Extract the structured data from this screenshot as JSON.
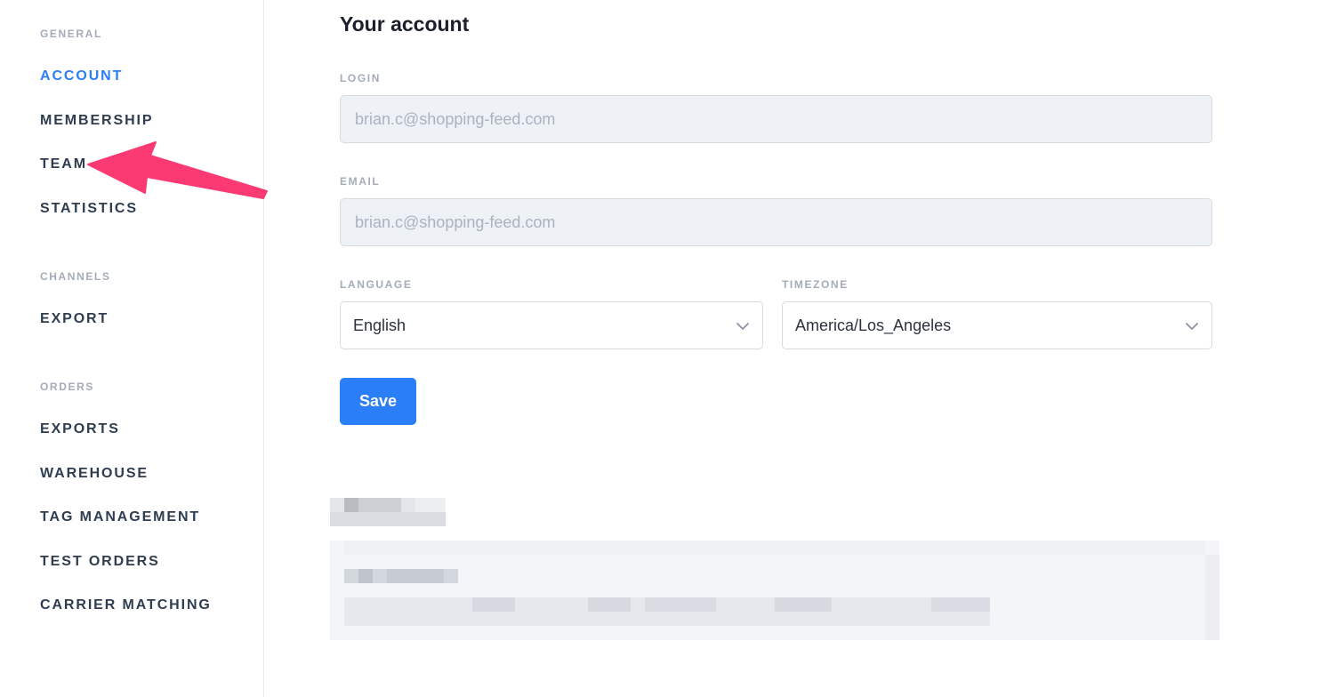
{
  "sidebar": {
    "groups": [
      {
        "title": "GENERAL",
        "items": [
          {
            "label": "ACCOUNT",
            "active": true
          },
          {
            "label": "MEMBERSHIP"
          },
          {
            "label": "TEAM"
          },
          {
            "label": "STATISTICS"
          }
        ]
      },
      {
        "title": "CHANNELS",
        "items": [
          {
            "label": "EXPORT"
          }
        ]
      },
      {
        "title": "ORDERS",
        "items": [
          {
            "label": "EXPORTS"
          },
          {
            "label": "WAREHOUSE"
          },
          {
            "label": "TAG MANAGEMENT"
          },
          {
            "label": "TEST ORDERS"
          },
          {
            "label": "CARRIER MATCHING"
          }
        ]
      }
    ]
  },
  "account": {
    "title": "Your account",
    "login": {
      "label": "LOGIN",
      "value": "brian.c@shopping-feed.com"
    },
    "email": {
      "label": "EMAIL",
      "value": "brian.c@shopping-feed.com"
    },
    "language": {
      "label": "LANGUAGE",
      "value": "English"
    },
    "timezone": {
      "label": "TIMEZONE",
      "value": "America/Los_Angeles"
    },
    "save_label": "Save"
  },
  "colors": {
    "accent": "#2a7ef8",
    "annotation_arrow": "#fb3a74",
    "nav_text": "#2f3d50",
    "muted_label": "#a4acb8",
    "disabled_bg": "#eef1f5"
  },
  "icons": {
    "select_chevron": "chevron-down-icon",
    "annotation": "arrow-annotation"
  }
}
